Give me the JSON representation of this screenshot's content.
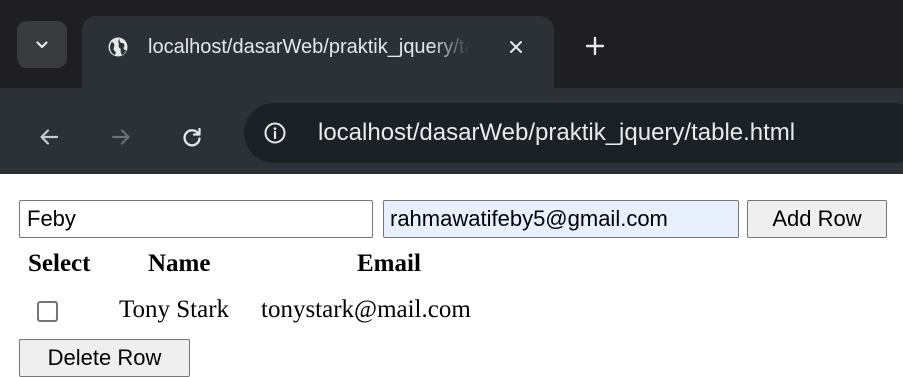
{
  "browser": {
    "tab": {
      "title": "localhost/dasarWeb/praktik_jquery/table.html",
      "favicon": "globe-icon"
    },
    "url": "localhost/dasarWeb/praktik_jquery/table.html",
    "icons": {
      "tab_search": "chevron-down-icon",
      "tab_close": "close-icon",
      "new_tab": "plus-icon",
      "back": "arrow-left-icon",
      "forward": "arrow-right-icon",
      "reload": "reload-icon",
      "site_info": "info-icon"
    },
    "colors": {
      "tabstrip": "#1f1f21",
      "toolbar": "#2b3137",
      "omnibox": "#1c2126"
    }
  },
  "form": {
    "name_value": "Feby",
    "email_value": "rahmawatifeby5@gmail.com",
    "add_label": "Add Row",
    "delete_label": "Delete Row"
  },
  "table": {
    "headers": [
      "Select",
      "Name",
      "Email"
    ],
    "rows": [
      {
        "selected": false,
        "name": "Tony Stark",
        "email": "tonystark@mail.com"
      }
    ]
  }
}
